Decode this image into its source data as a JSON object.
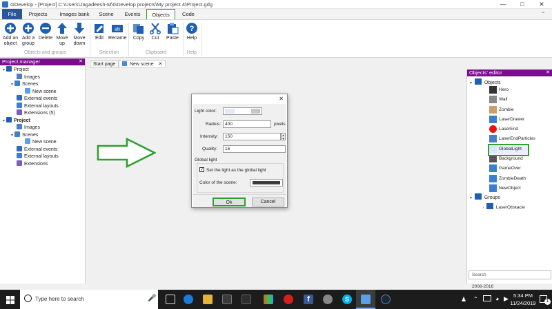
{
  "window": {
    "title": "GDevelop - [Project] C:\\Users\\Jagadeesh-M\\GDevelop projects\\My project 4\\Project.gdg"
  },
  "menu": {
    "tabs": [
      "File",
      "Projects",
      "Images bank",
      "Scene",
      "Events",
      "Objects",
      "Code"
    ],
    "active": "Objects"
  },
  "ribbon": {
    "buttons": {
      "add_object": "Add an object",
      "add_group": "Add a group",
      "delete": "Delete",
      "move_up": "Move up",
      "move_down": "Move down",
      "edit": "Edit",
      "rename": "Rename",
      "copy": "Copy",
      "cut": "Cut",
      "paste": "Paste",
      "help": "Help"
    },
    "groups": {
      "objects": "Objects and groups",
      "selection": "Selection",
      "clipboard": "Clipboard",
      "help": "Help"
    }
  },
  "project_manager": {
    "title": "Project manager",
    "tree": [
      {
        "label": "Project",
        "icon": "folder",
        "level": 0,
        "bold": false
      },
      {
        "label": "Images",
        "icon": "images",
        "level": 1
      },
      {
        "label": "Scenes",
        "icon": "scenes",
        "level": 1
      },
      {
        "label": "New scene",
        "icon": "scene",
        "level": 2
      },
      {
        "label": "External events",
        "icon": "events",
        "level": 1
      },
      {
        "label": "External layouts",
        "icon": "layouts",
        "level": 1
      },
      {
        "label": "Extensions (5)",
        "icon": "extensions",
        "level": 1
      },
      {
        "label": "Project",
        "icon": "folder",
        "level": 0,
        "bold": true
      },
      {
        "label": "Images",
        "icon": "images",
        "level": 1
      },
      {
        "label": "Scenes",
        "icon": "scenes",
        "level": 1
      },
      {
        "label": "New scene",
        "icon": "scene",
        "level": 2
      },
      {
        "label": "External events",
        "icon": "events",
        "level": 1
      },
      {
        "label": "External layouts",
        "icon": "layouts",
        "level": 1
      },
      {
        "label": "Extensions",
        "icon": "extensions",
        "level": 1
      }
    ]
  },
  "scene_tabs": {
    "start_page": "Start page",
    "new_scene": "New scene",
    "close": "✕"
  },
  "dialog": {
    "close": "✕",
    "light_color_label": "Light color:",
    "radius_label": "Radius:",
    "radius_value": "400",
    "radius_unit": "pixels",
    "intensity_label": "Intensity:",
    "intensity_value": "150",
    "quality_label": "Quality:",
    "quality_value": "16",
    "global_light_header": "Global light",
    "global_light_checkbox": "Set the light as the global light",
    "global_light_checked": true,
    "scene_color_label": "Color of the scene:",
    "scene_color": "#3c3c3c",
    "ok_label": "Ok",
    "cancel_label": "Cancel"
  },
  "objects_editor": {
    "title": "Objects' editor",
    "root": "Objects",
    "objects": [
      "Hero",
      "Wall",
      "Zombie",
      "LaserDrawer",
      "LaserEnd",
      "LaserEndParticles",
      "GlobalLight",
      "Background",
      "GameOver",
      "ZombieDeath",
      "NewObject"
    ],
    "selected": "GlobalLight",
    "groups_label": "Groups",
    "groups": [
      "LaserObstacle"
    ],
    "search_placeholder": "Search"
  },
  "status": {
    "copyright": "2008-2016"
  },
  "taskbar": {
    "search_placeholder": "Type here to search",
    "time": "5:34 PM",
    "date": "11/24/2019",
    "notification_count": "1"
  },
  "colors": {
    "accent_green": "#2ea02e",
    "panel_purple": "#7a0d8c",
    "file_blue": "#2b5797"
  }
}
